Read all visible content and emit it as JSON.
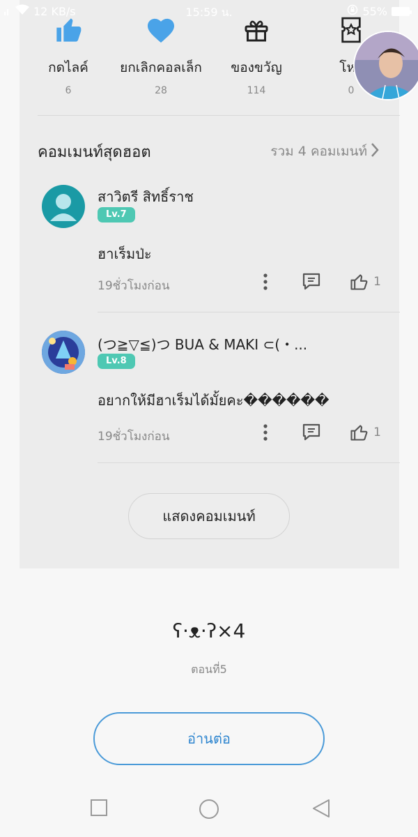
{
  "status": {
    "network_speed": "12 KB/s",
    "time": "15:59 น.",
    "battery_percent": "55%",
    "battery_level": 0.55
  },
  "actions": [
    {
      "label": "กดไลค์",
      "count": "6",
      "icon": "thumbs-up-filled-icon"
    },
    {
      "label": "ยกเลิกคอลเล็ก",
      "count": "28",
      "icon": "heart-filled-icon"
    },
    {
      "label": "ของขวัญ",
      "count": "114",
      "icon": "gift-icon"
    },
    {
      "label": "โหว",
      "count": "0",
      "icon": "vote-ticket-icon"
    }
  ],
  "hot_comments": {
    "title": "คอมเมนท์สุดฮอต",
    "total": "รวม 4 คอมเมนท์"
  },
  "comments": [
    {
      "username": "สาวิตรี สิทธิ์ราช",
      "level": "Lv.7",
      "text": "ฮาเร็มป่ะ",
      "time": "19ชั่วโมงก่อน",
      "likes": "1"
    },
    {
      "username": "(つ≧▽≦)つ BUA & MAKI ⊂(・...",
      "level": "Lv.8",
      "text": "อยากให้มีฮาเร็มได้มั้ยคะ������",
      "time": "19ชั่วโมงก่อน",
      "likes": "1"
    }
  ],
  "show_comments_label": "แสดงคอมเมนท์",
  "next_episode": {
    "title": "ʕ·ᴥ·ʔ×4",
    "episode": "ตอนที่5",
    "read_label": "อ่านต่อ"
  },
  "colors": {
    "accent": "#2f86cf",
    "icon_blue": "#4aa3e8",
    "level_badge": "#4ec8b3"
  }
}
